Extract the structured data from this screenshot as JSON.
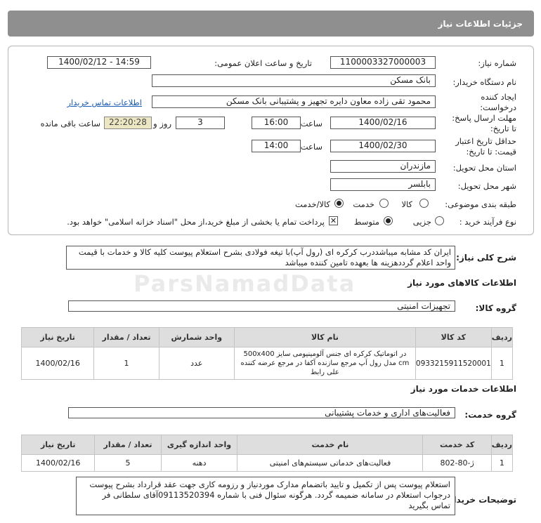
{
  "page": {
    "title": "جزئیات اطلاعات نیاز"
  },
  "fields": {
    "need_number_label": "شماره نیاز:",
    "need_number": "1100003327000003",
    "announce_label": "تاریخ و ساعت اعلان عمومی:",
    "announce_value": "1400/02/12 - 14:59",
    "buyer_label": "نام دستگاه خریدار:",
    "buyer": "بانک مسکن",
    "creator_label": "ایجاد کننده درخواست:",
    "creator": "محمود تقی زاده معاون دایره تجهیز و پشتیبانی بانک مسکن",
    "contact_link": "اطلاعات تماس خریدار",
    "send_deadline_label": "مهلت ارسال پاسخ: تا تاریخ:",
    "send_date": "1400/02/16",
    "time_label": "ساعت",
    "send_time": "16:00",
    "days_value": "3",
    "days_label": "روز و",
    "remaining_time": "22:20:28",
    "remaining_label": "ساعت باقی مانده",
    "price_validity_label": "حداقل تاریخ اعتبار قیمت: تا تاریخ:",
    "price_date": "1400/02/30",
    "price_time": "14:00",
    "province_label": "استان محل تحویل:",
    "province": "مازندران",
    "city_label": "شهر محل تحویل:",
    "city": "بابلسر",
    "category_label": "طبقه بندی موضوعی:",
    "category_options": [
      "کالا",
      "خدمت",
      "کالا/خدمت"
    ],
    "process_label": "نوع فرآیند خرید :",
    "process_options": [
      "جزیی",
      "متوسط"
    ],
    "payment_note": "پرداخت تمام یا بخشی از مبلغ خرید،از محل \"اسناد خزانه اسلامی\" خواهد بود."
  },
  "description": {
    "label": "شرح کلی نیاز:",
    "text": "ایران کد مشابه میباشددرب کرکره ای (رول آپ)با تیغه فولادی بشرح استعلام پیوست کلیه کالا و خدمات با قیمت واحد اعلام گرددهزینه ها بعهده تامین کننده میباشد"
  },
  "goods": {
    "section_title": "اطلاعات کالاهای مورد نیاز",
    "group_label": "گروه کالا:",
    "group_value": "تجهیزات امنیتی",
    "headers": [
      "ردیف",
      "کد کالا",
      "نام کالا",
      "واحد شمارش",
      "تعداد / مقدار",
      "تاریخ نیاز"
    ],
    "rows": [
      {
        "row": "1",
        "code": "0933215911520001",
        "name": "در اتوماتیک کرکره ای جنس آلومینیومی سایز 500x400 cm مدل رول آپ مرجع سازنده آکفا در مرجع عرضه کننده علی رابط",
        "unit": "عدد",
        "qty": "1",
        "date": "1400/02/16"
      }
    ]
  },
  "services": {
    "section_title": "اطلاعات خدمات مورد نیاز",
    "group_label": "گروه خدمت:",
    "group_value": "فعالیت‌های اداری و خدمات پشتیبانی",
    "headers": [
      "ردیف",
      "کد خدمت",
      "نام خدمت",
      "واحد اندازه گیری",
      "تعداد / مقدار",
      "تاریخ نیاز"
    ],
    "rows": [
      {
        "row": "1",
        "code": "ژ-80-802",
        "name": "فعالیت‌های خدماتی سیستم‌های امنیتی",
        "unit": "دهنه",
        "qty": "5",
        "date": "1400/02/16"
      }
    ]
  },
  "buyer_notes": {
    "label": "توضیحات خریدار:",
    "text": "استعلام پیوست پس از تکمیل و تایید باتضمام مدارک موردنیاز و رزومه کاری جهت عقد قرارداد بشرح پیوست درجواب استعلام در سامانه ضمیمه گردد. هرگونه سئوال فنی با شماره 09113520394آقای سلطانی فر تماس بگیرید"
  },
  "watermark": "ParsNamadData"
}
